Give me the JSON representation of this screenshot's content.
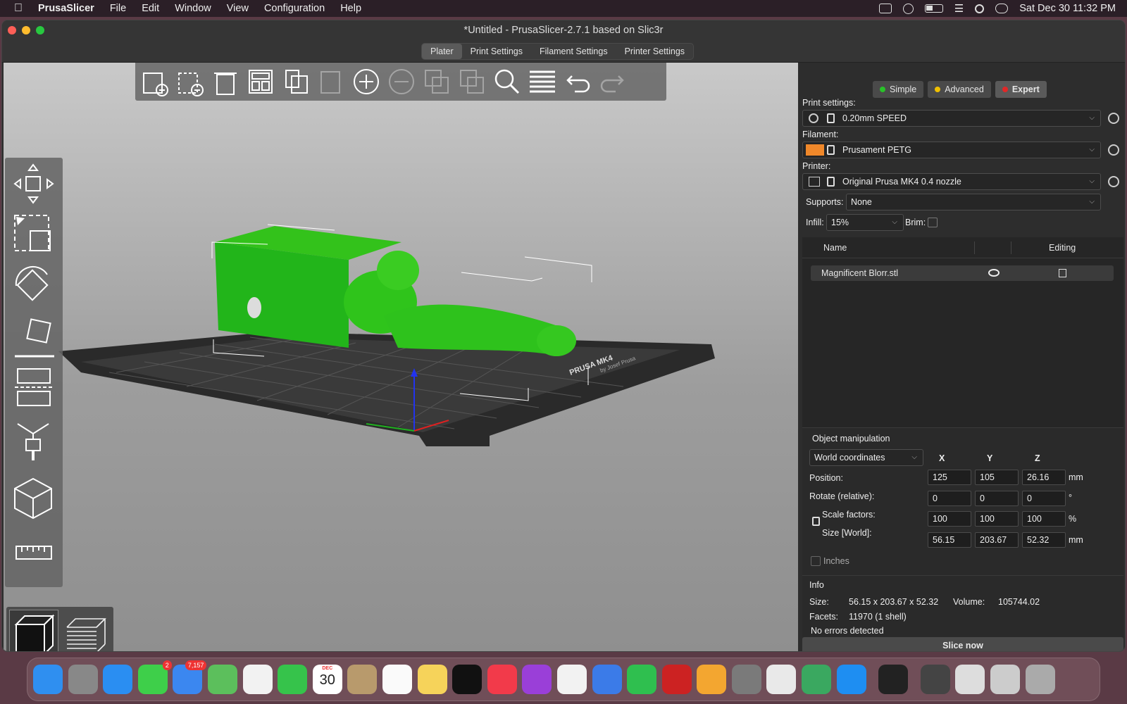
{
  "menubar": {
    "app": "PrusaSlicer",
    "items": [
      "File",
      "Edit",
      "Window",
      "View",
      "Configuration",
      "Help"
    ],
    "clock": "Sat Dec 30  11:32 PM"
  },
  "window": {
    "title": "*Untitled - PrusaSlicer-2.7.1 based on Slic3r"
  },
  "tabs": [
    "Plater",
    "Print Settings",
    "Filament Settings",
    "Printer Settings"
  ],
  "toolbar": {
    "icons": [
      "add-icon",
      "delete-icon",
      "delete-all-icon",
      "arrange-icon",
      "copy-icon",
      "paste-icon",
      "add-instance-icon",
      "remove-instance-icon",
      "split-objects-icon",
      "split-parts-icon",
      "search-icon",
      "layers-editing-icon",
      "undo-icon",
      "redo-icon"
    ],
    "disabled": [
      false,
      false,
      false,
      false,
      false,
      true,
      false,
      true,
      true,
      true,
      false,
      false,
      false,
      true
    ]
  },
  "left_tools": [
    "move-icon",
    "scale-icon",
    "rotate-icon",
    "place-on-face-icon",
    "cut-icon",
    "paint-supports-icon",
    "seam-painting-icon",
    "measure-icon"
  ],
  "modes": {
    "simple": "Simple",
    "advanced": "Advanced",
    "expert": "Expert",
    "colors": {
      "simple": "#29c129",
      "advanced": "#f0c000",
      "expert": "#e02828"
    }
  },
  "settings": {
    "print_label": "Print settings:",
    "print_value": "0.20mm SPEED",
    "filament_label": "Filament:",
    "filament_value": "Prusament PETG",
    "filament_color": "#f0882a",
    "printer_label": "Printer:",
    "printer_value": "Original Prusa MK4 0.4 nozzle",
    "supports_label": "Supports:",
    "supports_value": "None",
    "infill_label": "Infill:",
    "infill_value": "15%",
    "brim_label": "Brim:"
  },
  "object_list": {
    "col_name": "Name",
    "col_editing": "Editing",
    "objects": [
      {
        "name": "Magnificent Blorr.stl"
      }
    ]
  },
  "object_manipulation": {
    "title": "Object manipulation",
    "coord_system": "World coordinates",
    "axes": [
      "X",
      "Y",
      "Z"
    ],
    "position_label": "Position:",
    "rotate_label": "Rotate (relative):",
    "scale_label": "Scale factors:",
    "size_label": "Size [World]:",
    "position": [
      "125",
      "105",
      "26.16"
    ],
    "rotate": [
      "0",
      "0",
      "0"
    ],
    "scale": [
      "100",
      "100",
      "100"
    ],
    "size": [
      "56.15",
      "203.67",
      "52.32"
    ],
    "units": {
      "position": "mm",
      "rotate": "°",
      "scale": "%",
      "size": "mm"
    },
    "inches_label": "Inches"
  },
  "info": {
    "title": "Info",
    "size_label": "Size:",
    "size_value": "56.15 x 203.67 x 52.32",
    "volume_label": "Volume:",
    "volume_value": "105744.02",
    "facets_label": "Facets:",
    "facets_value": "11970 (1 shell)",
    "errors": "No errors detected"
  },
  "slice_button": "Slice now",
  "bed": {
    "brand": "PRUSA MK4",
    "sub": "by Josef Prusa"
  },
  "dock": {
    "apps": [
      "Finder",
      "Launchpad",
      "Safari",
      "Messages",
      "Mail",
      "Maps",
      "Photos",
      "FaceTime",
      "Calendar",
      "Contacts",
      "Reminders",
      "Notes",
      "TV",
      "Music",
      "Podcasts",
      "News",
      "Keynote",
      "Numbers",
      "PrusaSlicer",
      "Pages",
      "System Settings",
      "Chrome",
      "Chrome Canary",
      "App Store",
      "Blender",
      "Downloads",
      "Stack",
      "Stack",
      "Trash"
    ],
    "colors": [
      "#2f8ff0",
      "#888",
      "#2a8ef2",
      "#3ecf4a",
      "#3b87f0",
      "#5cbf5c",
      "#f2f2f2",
      "#36c34b",
      "#ffffff",
      "#b89a6c",
      "#fafafa",
      "#f6d35a",
      "#111",
      "#f23a4a",
      "#9a3fd8",
      "#f2f2f2",
      "#3b7be8",
      "#2fbf4f",
      "#c22",
      "#f3a630",
      "#7a7a7a",
      "#e9e9e9",
      "#3aa860",
      "#1e8ef2",
      "#222",
      "#444",
      "#ddd",
      "#ccc",
      "#aaa"
    ],
    "calendar_month": "DEC",
    "calendar_day": "30",
    "messages_badge": "2",
    "mail_badge": "7,157"
  }
}
